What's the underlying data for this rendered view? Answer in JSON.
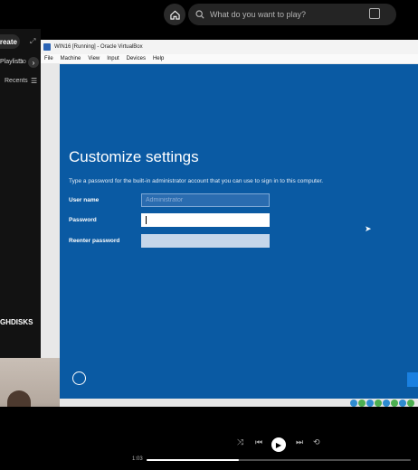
{
  "topbar": {
    "search_placeholder": "What do you want to play?",
    "icons": [
      "home-icon",
      "search-icon",
      "browse-icon"
    ]
  },
  "library": {
    "create_label": "Create",
    "chip_playlists": "Playlists",
    "chip_downloaded": "Do",
    "recents_label": "Recents",
    "playlist_name": "GHDISKS"
  },
  "vbox": {
    "title": "WIN16 [Running] - Oracle VirtualBox",
    "menu": [
      "File",
      "Machine",
      "View",
      "Input",
      "Devices",
      "Help"
    ]
  },
  "setup": {
    "title": "Customize settings",
    "description": "Type a password for the built-in administrator account that you can use to sign in to this computer.",
    "username_label": "User name",
    "username_placeholder": "Administrator",
    "password_label": "Password",
    "reenter_label": "Reenter password"
  },
  "player": {
    "elapsed": "1:03",
    "progress_fraction": 0.35
  },
  "colors": {
    "oobe_blue": "#0a5aa3",
    "spotify_bg": "#000000"
  }
}
